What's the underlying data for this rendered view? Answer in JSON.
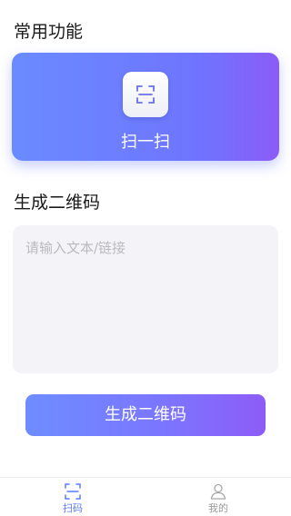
{
  "sections": {
    "common_title": "常用功能",
    "generate_title": "生成二维码"
  },
  "scan_card": {
    "label": "扫一扫",
    "icon": "scan-icon"
  },
  "generate": {
    "placeholder": "请输入文本/链接",
    "value": "",
    "button_label": "生成二维码"
  },
  "tabbar": {
    "tabs": [
      {
        "label": "扫码",
        "icon": "scan-icon",
        "active": true
      },
      {
        "label": "我的",
        "icon": "user-icon",
        "active": false
      }
    ]
  },
  "colors": {
    "accent": "#6f7cff",
    "accent_end": "#8b5cf7",
    "active_tab": "#5b7cff",
    "inactive_tab": "#9a9a9a",
    "input_bg": "#f4f4f8"
  }
}
